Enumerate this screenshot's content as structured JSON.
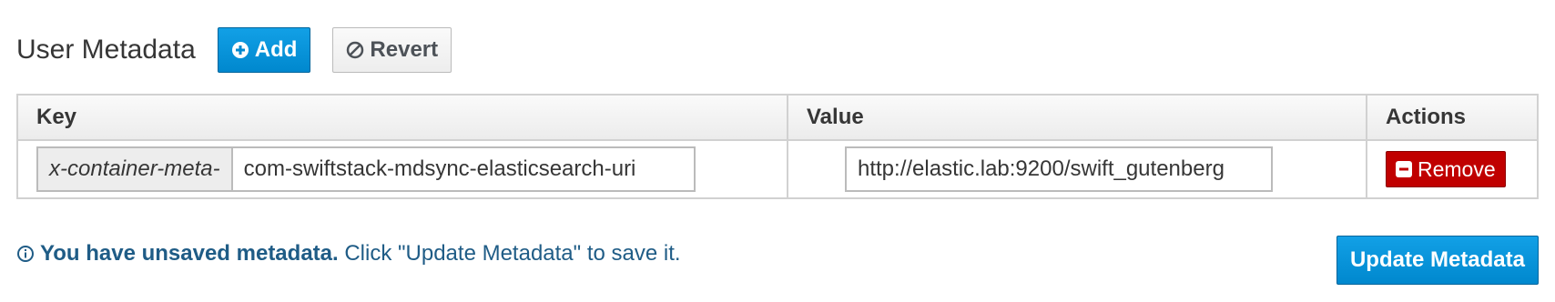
{
  "header": {
    "title": "User Metadata",
    "add_label": "Add",
    "revert_label": "Revert"
  },
  "table": {
    "columns": [
      "Key",
      "Value",
      "Actions"
    ],
    "rows": [
      {
        "key_prefix": "x-container-meta-",
        "key_value": "com-swiftstack-mdsync-elasticsearch-uri",
        "value": "http://elastic.lab:9200/swift_gutenberg",
        "remove_label": "Remove"
      }
    ]
  },
  "notice": {
    "bold_text": "You have unsaved metadata.",
    "text": " Click \"Update Metadata\" to save it."
  },
  "update_label": "Update Metadata",
  "colors": {
    "primary": "#0088ce",
    "danger": "#c00000",
    "notice_text": "#1f5c86"
  },
  "icons": {
    "add": "plus-circle-icon",
    "revert": "ban-icon",
    "remove": "minus-square-icon",
    "notice": "info-circle-icon"
  }
}
